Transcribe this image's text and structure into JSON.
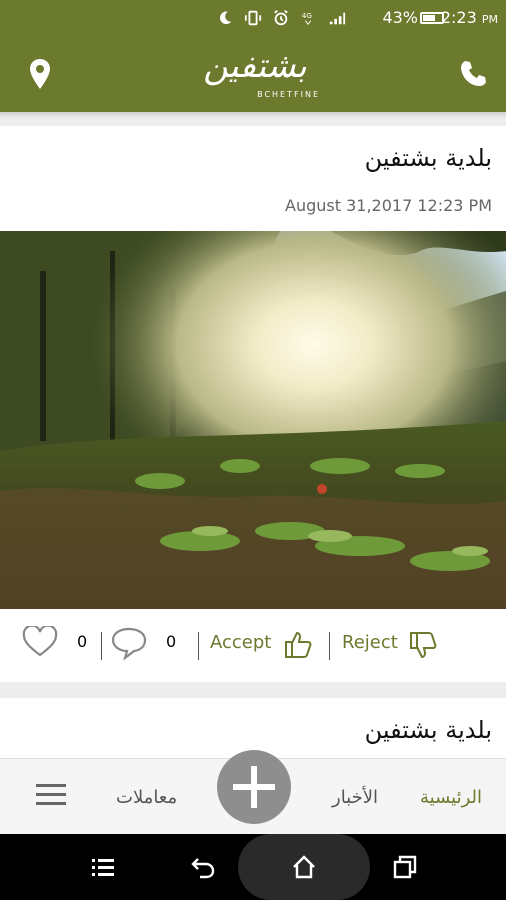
{
  "status_bar": {
    "battery_percent": "43%",
    "time": "2:23",
    "time_suffix": "PM",
    "network": "4G"
  },
  "header": {
    "logo_arabic": "بشتفين",
    "logo_latin": "BCHETFINE",
    "brand_color": "#6b7a2d"
  },
  "post": {
    "title": "بلدية بشتفين",
    "date": "August 31,2017 12:23 PM",
    "likes_count": "0",
    "comments_count": "0",
    "accept_label": "Accept",
    "reject_label": "Reject"
  },
  "post2": {
    "title": "بلدية بشتفين"
  },
  "bottom_nav": {
    "home_label": "الرئيسية",
    "news_label": "الأخبار",
    "transactions_label": "معاملات"
  }
}
